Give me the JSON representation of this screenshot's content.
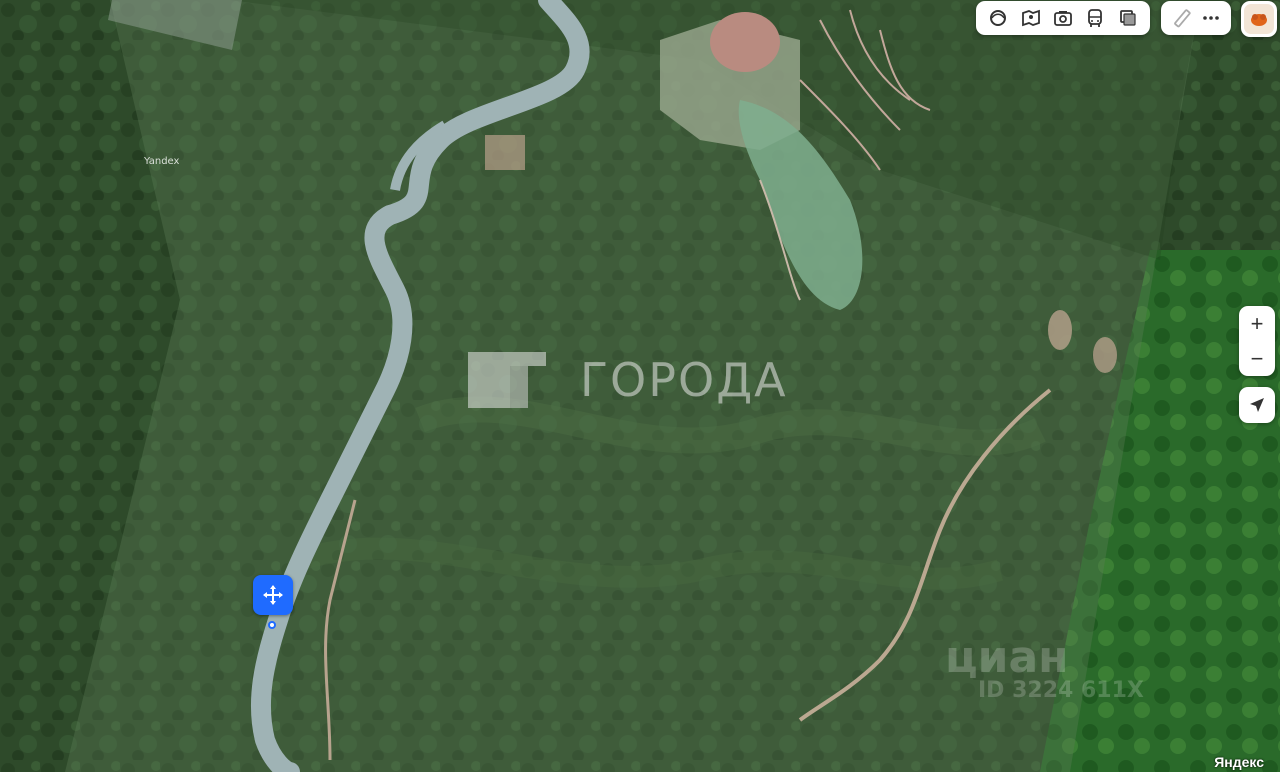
{
  "map": {
    "type": "satellite",
    "colors": {
      "forest": "#2f4d2b",
      "river": "#9db2b4",
      "accent": "#1f6bff"
    }
  },
  "toolbar": {
    "layers": [
      "layers-icon",
      "panorama-icon",
      "photo-icon",
      "transport-icon",
      "traffic-icon"
    ],
    "tools": [
      "ruler-icon",
      "more-icon"
    ]
  },
  "controls": {
    "zoom_in": "+",
    "zoom_out": "−"
  },
  "watermark": {
    "text": "ГОРОДА"
  },
  "labels": {
    "tile_watermark": "Yandex",
    "cian": "циан",
    "cian_id": "ID 3224 611X"
  },
  "copyright": "Яндекс"
}
